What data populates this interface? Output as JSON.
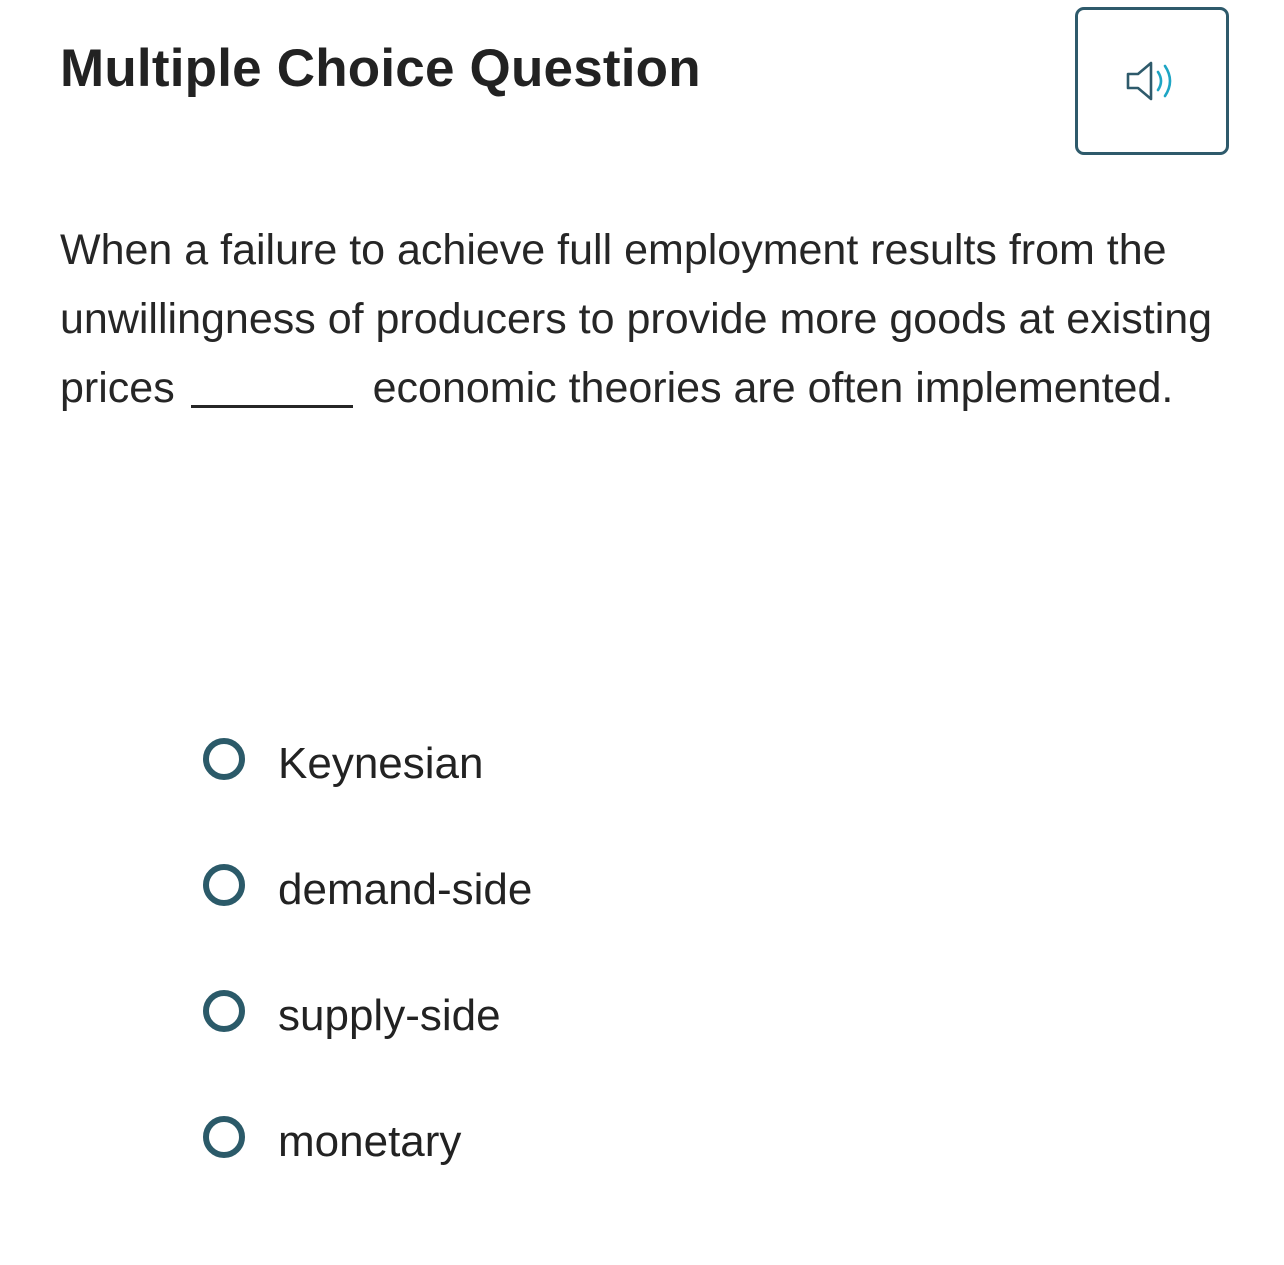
{
  "header": {
    "title": "Multiple Choice Question",
    "audio_icon": "speaker-icon",
    "colors": {
      "button_border": "#2e5a6b",
      "icon_waves": "#1ea5c4"
    }
  },
  "question": {
    "part1": "When a failure to achieve full employment results from the unwillingness of producers to provide more goods at existing prices",
    "part2": "economic theories are often implemented."
  },
  "choices": [
    {
      "label": "Keynesian"
    },
    {
      "label": "demand-side"
    },
    {
      "label": "supply-side"
    },
    {
      "label": "monetary"
    }
  ],
  "colors": {
    "radio": "#2b5a69",
    "text": "#222222"
  }
}
